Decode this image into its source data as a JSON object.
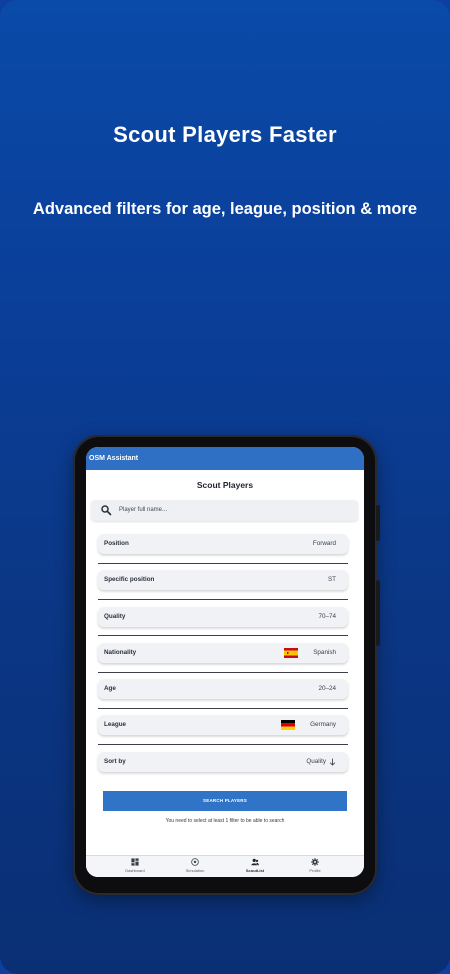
{
  "promo": {
    "headline": "Scout Players Faster",
    "subline": "Advanced filters for age, league, position & more"
  },
  "app": {
    "title": "OSM Assistant",
    "page_title": "Scout Players",
    "search": {
      "placeholder": "Player full name..."
    },
    "filters": [
      {
        "label": "Position",
        "value": "Forward"
      },
      {
        "label": "Specific position",
        "value": "ST"
      },
      {
        "label": "Quality",
        "value": "70–74"
      },
      {
        "label": "Nationality",
        "value": "Spanish",
        "flag": "spain-flag"
      },
      {
        "label": "Age",
        "value": "20–24"
      },
      {
        "label": "League",
        "value": "Germany",
        "flag": "germany-flag"
      },
      {
        "label": "Sort by",
        "value": "Quality",
        "icon": "arrow-down-icon"
      }
    ],
    "search_button": "SEARCH PLAYERS",
    "hint": "You need to select at least 1 filter to be able to search",
    "nav": [
      {
        "label": "Dashboard",
        "icon": "dashboard-icon"
      },
      {
        "label": "Simulation",
        "icon": "soccer-ball-icon"
      },
      {
        "label": "ScoutList",
        "icon": "scout-people-icon",
        "active": true
      },
      {
        "label": "Profile",
        "icon": "gear-icon"
      }
    ]
  },
  "colors": {
    "background_top": "#0a4aa8",
    "background_bottom": "#0a2f74",
    "appbar": "#2f6fc4",
    "button": "#2f74c6"
  }
}
